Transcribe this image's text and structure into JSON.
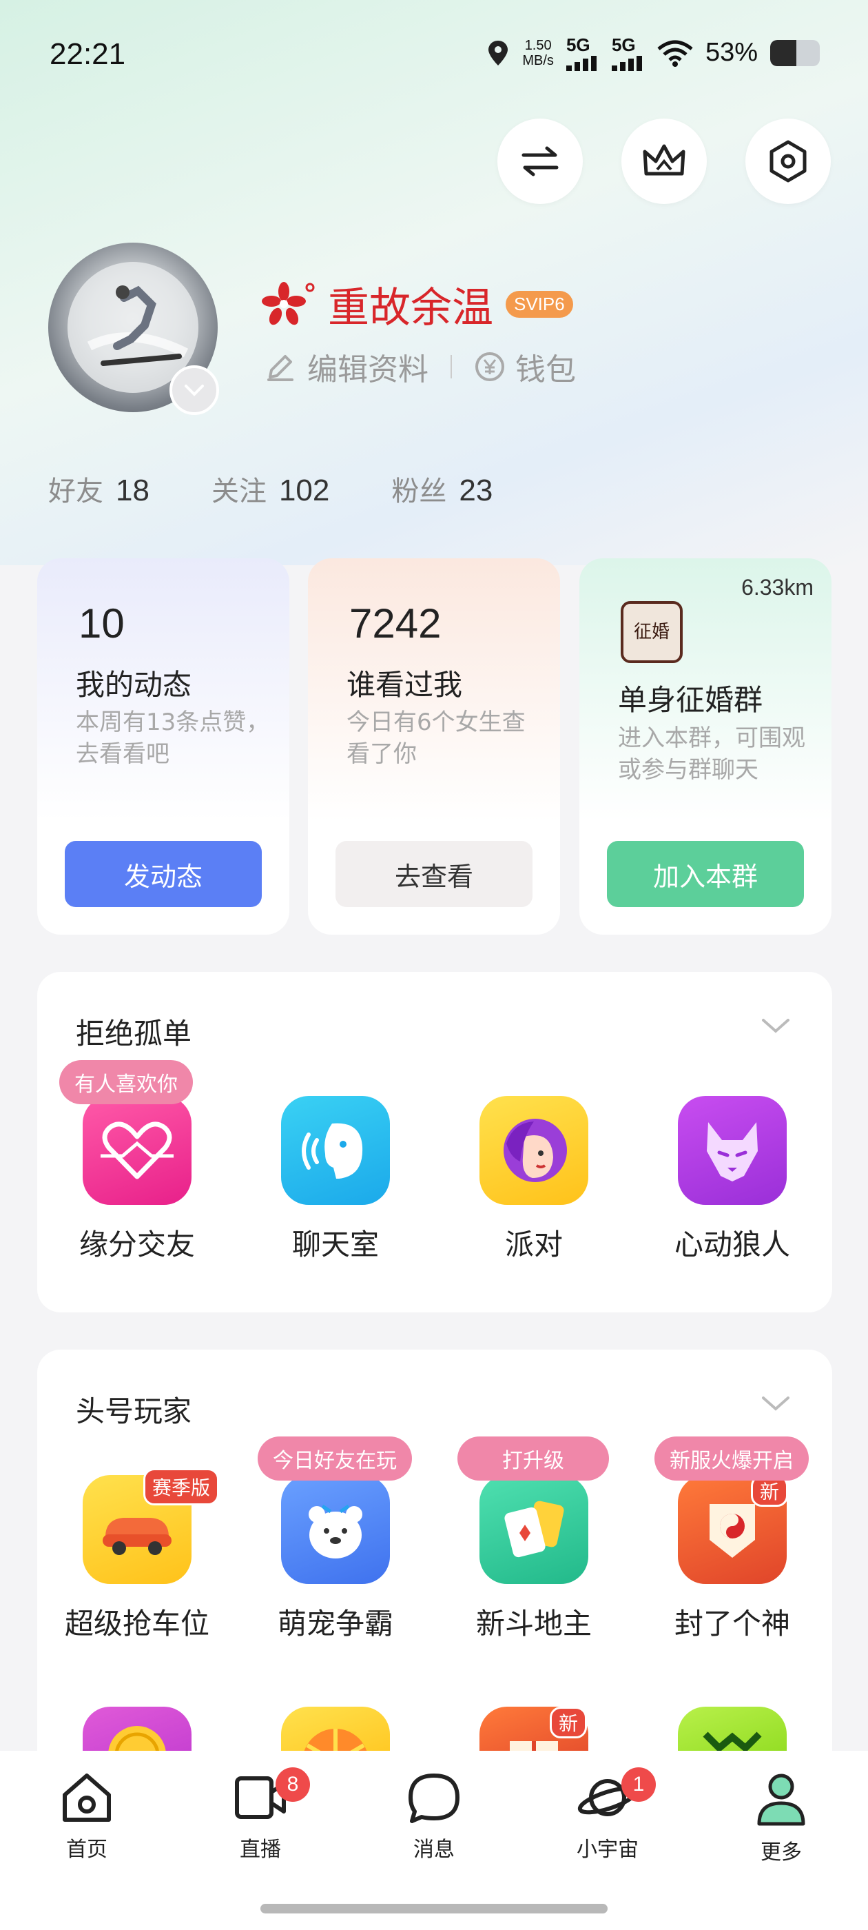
{
  "status_bar": {
    "time": "22:21",
    "net_speed_value": "1.50",
    "net_speed_unit": "MB/s",
    "signal_1": "5G",
    "signal_2": "5G",
    "battery_percent": "53%",
    "battery_level": 0.53
  },
  "top_actions": [
    "switch-icon",
    "crown-icon",
    "settings-hexagon-icon"
  ],
  "profile": {
    "nickname": "重故余温",
    "vip_badge": "SVIP6",
    "edit_label": "编辑资料",
    "wallet_label": "钱包"
  },
  "stats": [
    {
      "label": "好友",
      "value": "18"
    },
    {
      "label": "关注",
      "value": "102"
    },
    {
      "label": "粉丝",
      "value": "23"
    }
  ],
  "cards": {
    "moments": {
      "count": "10",
      "title": "我的动态",
      "desc": "本周有13条点赞，去看看吧",
      "button": "发动态"
    },
    "visitors": {
      "count": "7242",
      "title": "谁看过我",
      "desc": "今日有6个女生查看了你",
      "button": "去查看"
    },
    "group": {
      "distance": "6.33km",
      "logo_text": "征婚",
      "title": "单身征婚群",
      "desc": "进入本群，可围观或参与群聊天",
      "button": "加入本群"
    }
  },
  "section_social": {
    "title": "拒绝孤单",
    "items": [
      {
        "label": "缘分交友",
        "tag": "有人喜欢你"
      },
      {
        "label": "聊天室"
      },
      {
        "label": "派对"
      },
      {
        "label": "心动狼人"
      }
    ]
  },
  "section_games": {
    "title": "头号玩家",
    "items": [
      {
        "label": "超级抢车位",
        "corner": "赛季版"
      },
      {
        "label": "萌宠争霸",
        "tag": "今日好友在玩"
      },
      {
        "label": "新斗地主",
        "tag": "打升级"
      },
      {
        "label": "封了个神",
        "tag": "新服火爆开启",
        "corner": "新"
      }
    ],
    "partial_corner": "新"
  },
  "tabbar": {
    "items": [
      {
        "label": "首页"
      },
      {
        "label": "直播",
        "badge": "8"
      },
      {
        "label": "消息"
      },
      {
        "label": "小宇宙",
        "badge": "1"
      },
      {
        "label": "更多"
      }
    ]
  },
  "colors": {
    "accent_blue": "#5b7ff5",
    "accent_green": "#5ccf9a",
    "nickname_red": "#d8262a",
    "svip_orange": "#f49a4c",
    "tag_pink": "#f087a9",
    "badge_red": "#ef4a4a"
  }
}
